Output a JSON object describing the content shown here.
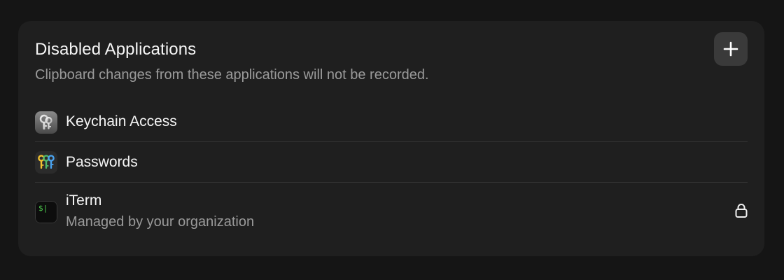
{
  "section": {
    "title": "Disabled Applications",
    "subtitle": "Clipboard changes from these applications will not be recorded."
  },
  "actions": {
    "add_icon": "plus-icon"
  },
  "apps": [
    {
      "name": "Keychain Access",
      "icon": "keychain-access-icon"
    },
    {
      "name": "Passwords",
      "icon": "passwords-icon"
    },
    {
      "name": "iTerm",
      "subtitle": "Managed by your organization",
      "icon": "iterm-icon",
      "status_icon": "lock-icon",
      "terminal_prompt": "$|"
    }
  ],
  "colors": {
    "background": "#151515",
    "card": "#1f1f1f",
    "button": "#3a3a3a",
    "secondary_text": "#9a9a9a",
    "terminal_green": "#4fd04f"
  }
}
